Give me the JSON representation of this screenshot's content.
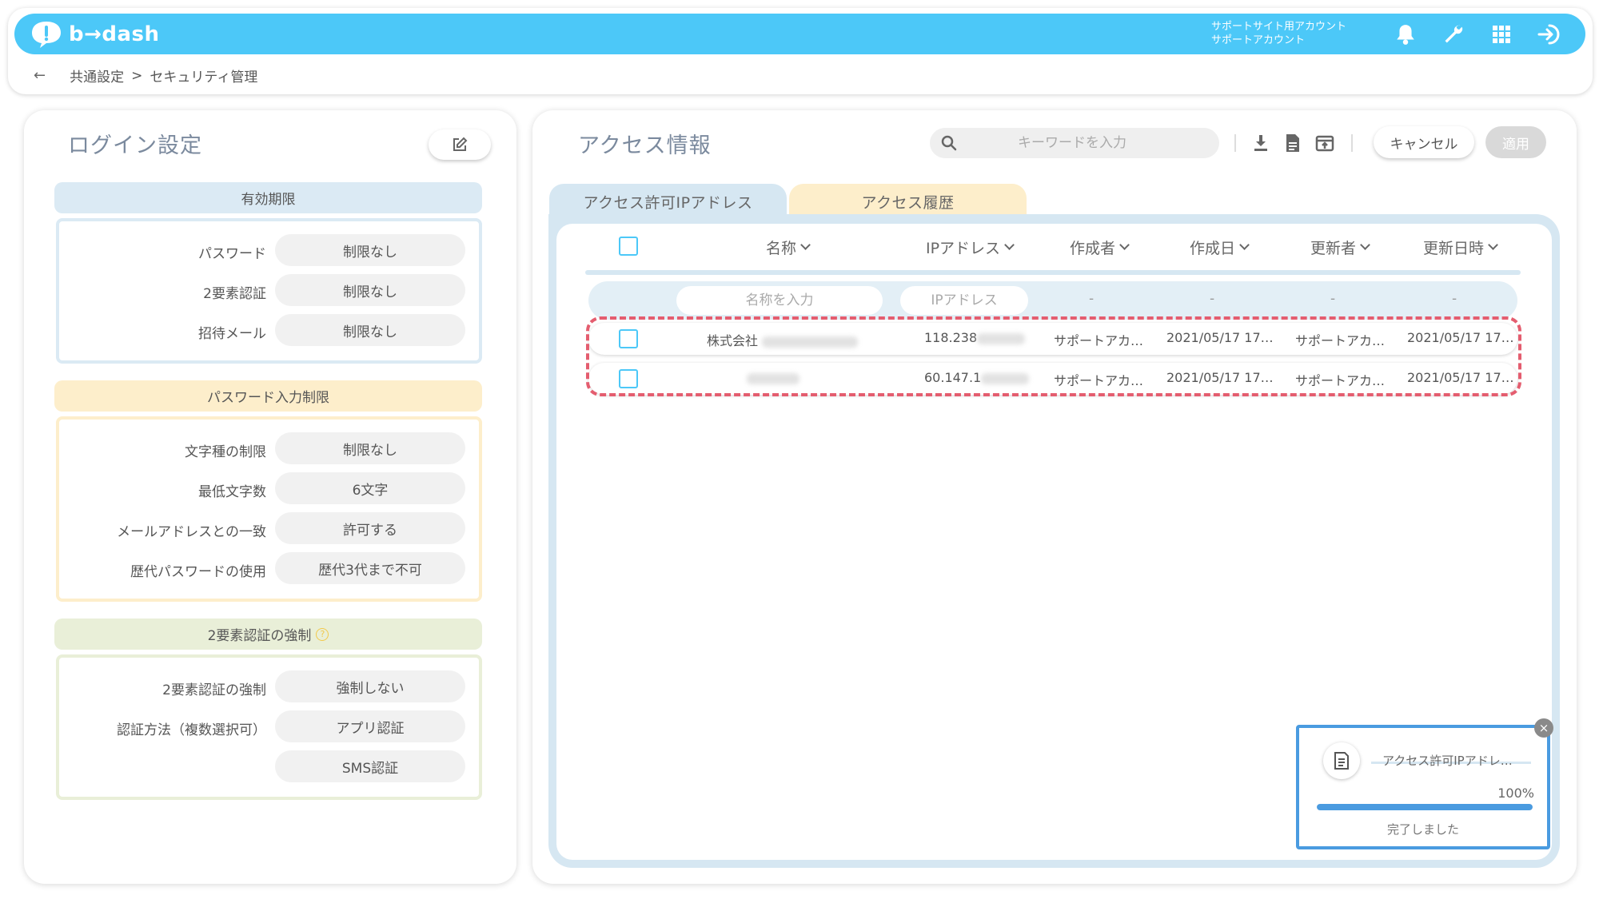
{
  "header": {
    "logo_text": "b→dash",
    "account_line1": "サポートサイト用アカウント",
    "account_line2": "サポートアカウント",
    "icons": [
      "bell-icon",
      "wrench-icon",
      "grid-icon",
      "logout-icon"
    ],
    "accent_color": "#4cc8f8"
  },
  "breadcrumb": {
    "back": "←",
    "items": [
      "共通設定",
      "セキュリティ管理"
    ],
    "separator": ">"
  },
  "login_settings": {
    "title": "ログイン設定",
    "sections": [
      {
        "heading": "有効期限",
        "rows": [
          {
            "label": "パスワード",
            "value": "制限なし"
          },
          {
            "label": "2要素認証",
            "value": "制限なし"
          },
          {
            "label": "招待メール",
            "value": "制限なし"
          }
        ]
      },
      {
        "heading": "パスワード入力制限",
        "rows": [
          {
            "label": "文字種の制限",
            "value": "制限なし"
          },
          {
            "label": "最低文字数",
            "value": "6文字"
          },
          {
            "label": "メールアドレスとの一致",
            "value": "許可する"
          },
          {
            "label": "歴代パスワードの使用",
            "value": "歴代3代まで不可"
          }
        ]
      },
      {
        "heading": "2要素認証の強制",
        "rows": [
          {
            "label": "2要素認証の強制",
            "value": "強制しない"
          },
          {
            "label": "認証方法（複数選択可）",
            "value": "アプリ認証"
          },
          {
            "label": "",
            "value": "SMS認証"
          }
        ]
      }
    ]
  },
  "access_info": {
    "title": "アクセス情報",
    "search_placeholder": "キーワードを入力",
    "cancel_label": "キャンセル",
    "apply_label": "適用",
    "tabs": [
      "アクセス許可IPアドレス",
      "アクセス履歴"
    ],
    "columns": [
      "名称",
      "IPアドレス",
      "作成者",
      "作成日",
      "更新者",
      "更新日時"
    ],
    "filter": {
      "name_placeholder": "名称を入力",
      "ip_placeholder": "IPアドレス",
      "dash": "-"
    },
    "rows": [
      {
        "name": "株式会社",
        "ip": "118.238",
        "creator": "サポートアカ…",
        "created": "2021/05/17 17…",
        "updater": "サポートアカ…",
        "updated": "2021/05/17 17…"
      },
      {
        "name": "",
        "ip": "60.147.1",
        "creator": "サポートアカ…",
        "created": "2021/05/17 17…",
        "updater": "サポートアカ…",
        "updated": "2021/05/17 17…"
      }
    ]
  },
  "toast": {
    "file_name": "アクセス許可IPアドレ…",
    "progress_label": "100%",
    "progress": 1.0,
    "status": "完了しました",
    "close": "×"
  }
}
